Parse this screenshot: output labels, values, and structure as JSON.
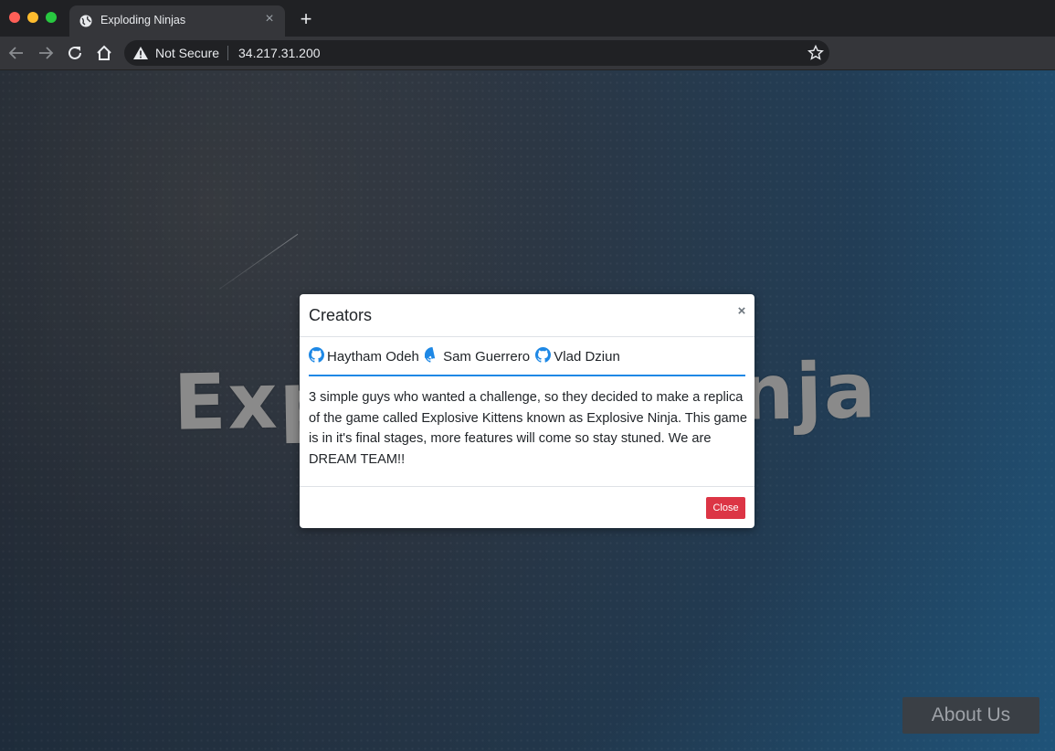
{
  "browser": {
    "tab_title": "Exploding Ninjas",
    "close_tab_glyph": "×",
    "new_tab_glyph": "+",
    "security_label": "Not Secure",
    "url": "34.217.31.200"
  },
  "page": {
    "logo_text": "Exploding Ninja",
    "about_label": "About Us"
  },
  "modal": {
    "title": "Creators",
    "close_glyph": "×",
    "creators": [
      {
        "name": "Haytham Odeh",
        "icon": "github-icon"
      },
      {
        "name": "Sam Guerrero",
        "icon": "github-icon"
      },
      {
        "name": "Vlad Dziun",
        "icon": "github-icon"
      }
    ],
    "body_text": "3 simple guys who wanted a challenge, so they decided to make a replica of the game called Explosive Kittens known as Explosive Ninja. This game is in it's final stages, more features will come so stay stuned. We are DREAM TEAM!!",
    "close_button_label": "Close"
  },
  "colors": {
    "accent_rule": "#1e88e5",
    "close_button": "#dc3545",
    "github_icon": "#1e88e5"
  }
}
